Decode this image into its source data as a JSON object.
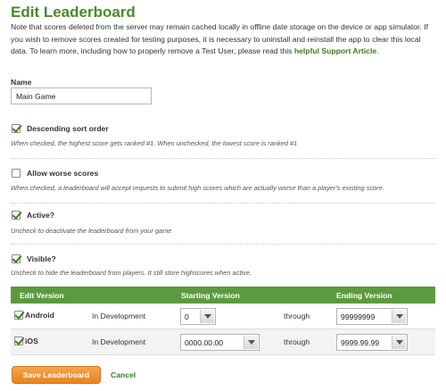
{
  "page": {
    "title": "Edit Leaderboard",
    "note_text": "Note that scores deleted from the server may remain cached locally in offline date storage on the device or app simulator. If you wish to remove scores created for testing purposes, it is necessary to uninstall and reinstall the app to clear this local data. To learn more, including how to properly remove a Test User, please read this ",
    "note_link": "helpful Support Article",
    "note_end": "."
  },
  "form": {
    "name_label": "Name",
    "name_value": "Main Game",
    "descending": {
      "label": "Descending sort order",
      "checked": true,
      "help": "When checked, the highest score gets ranked #1. When unchecked, the lowest score is ranked #1"
    },
    "worse": {
      "label": "Allow worse scores",
      "checked": false,
      "help": "When checked, a leaderboard will accept requests to submit high scores which are actually worse than a player's existing score."
    },
    "active": {
      "label": "Active?",
      "checked": true,
      "help": "Uncheck to deactivate the leaderboard from your game"
    },
    "visible": {
      "label": "Visible?",
      "checked": true,
      "help": "Uncheck to hide the leaderboard from players. It still store highscores when active."
    }
  },
  "versions": {
    "headers": {
      "edit": "Edit Version",
      "starting": "Starting Version",
      "ending": "Ending Version"
    },
    "rows": [
      {
        "platform": "Android",
        "checked": true,
        "status": "In Development",
        "start": "0",
        "through": "through",
        "end": "99999999"
      },
      {
        "platform": "iOS",
        "checked": true,
        "status": "In Development",
        "start": "0000.00.00",
        "through": "through",
        "end": "9999.99.99"
      }
    ]
  },
  "actions": {
    "save_label": "Save Leaderboard",
    "cancel_label": "Cancel"
  },
  "colors": {
    "title": "#4a8a2c",
    "table_header": "#5d9a3f",
    "save_button": "#f09530",
    "link": "#3d7d22"
  }
}
